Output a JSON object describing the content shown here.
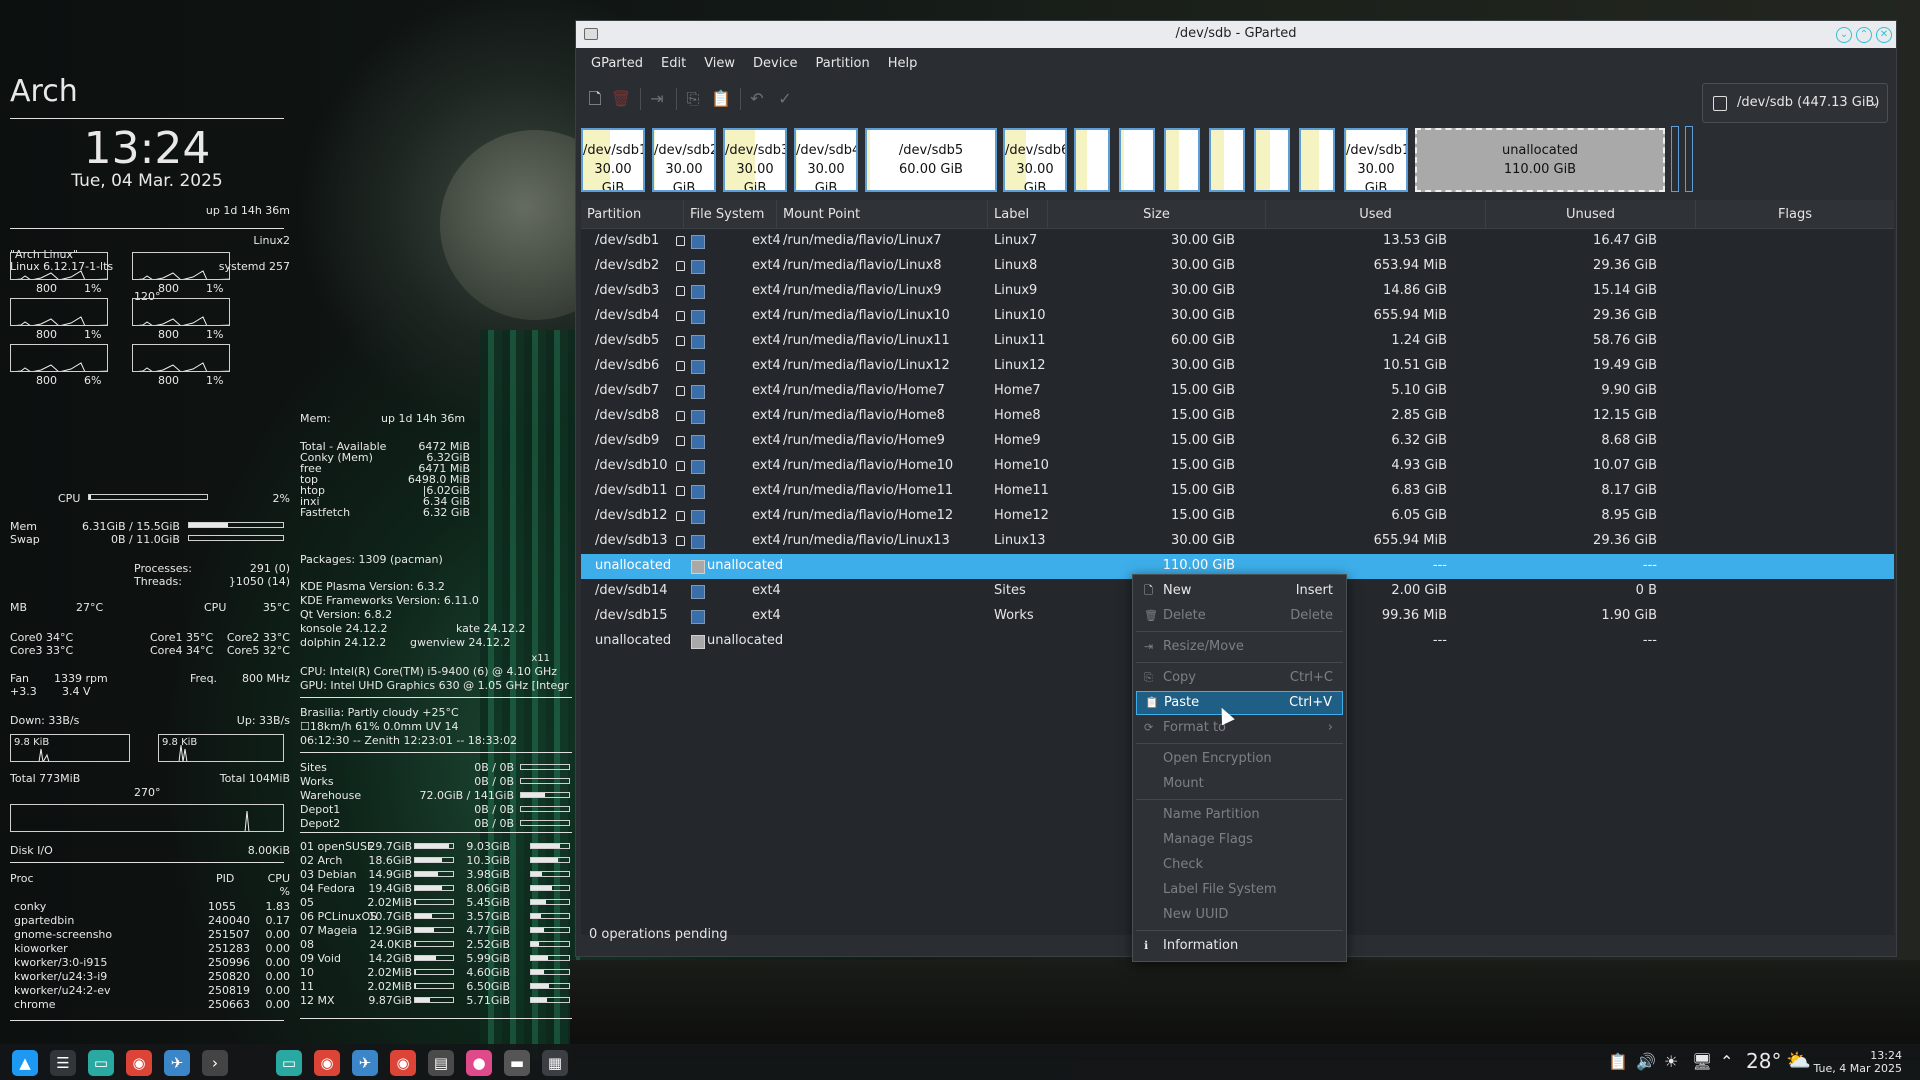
{
  "conky": {
    "distro": "Arch",
    "time": "13:24",
    "date": "Tue, 04 Mar. 2025",
    "uptime": "up  1d 14h 36m",
    "kernel_label": "Linux2",
    "os_name": "\"Arch Linux\"",
    "kernel": "Linux 6.12.17-1-lts",
    "systemd": "systemd 257",
    "cpu_temp_label": "120°",
    "cpu_cores": [
      {
        "freq": "800",
        "pct": "1%"
      },
      {
        "freq": "800",
        "pct": "1%"
      },
      {
        "freq": "800",
        "pct": "1%"
      },
      {
        "freq": "800",
        "pct": "1%"
      },
      {
        "freq": "800",
        "pct": "6%"
      },
      {
        "freq": "800",
        "pct": "1%"
      }
    ],
    "cpu_label": "CPU",
    "cpu_total": "2%",
    "cpu_total_value": 0.02,
    "mem_label": "Mem",
    "mem_value": "6.31GiB / 15.5GiB",
    "mem_fraction": 0.41,
    "swap_label": "Swap",
    "swap_value": "0B / 11.0GiB",
    "swap_fraction": 0.0,
    "processes_label": "Processes:",
    "processes": "291 (0)",
    "threads_label": "Threads:",
    "threads": "}1050 (14)",
    "mb_label": "MB",
    "mb_temp": "27°C",
    "cpu_temp_label2": "CPU",
    "cpu_temp": "35°C",
    "core_temps": [
      "Core0  34°C",
      "Core1  35°C",
      "Core2  33°C",
      "Core3  33°C",
      "Core4  34°C",
      "Core5  32°C"
    ],
    "fan_label": "Fan",
    "fan": "1339 rpm",
    "freq_label": "Freq.",
    "freq": "800   MHz",
    "volt1": "+3.3",
    "volt2": "3.4 V",
    "down": "Down: 33B/s",
    "up": "Up: 33B/s",
    "down_graph": "9.8 KiB",
    "up_graph": "9.8 KiB",
    "total_down": "Total 773MiB",
    "total_up": "Total 104MiB",
    "io_angle": "270°",
    "disk_io_label": "Disk I/O",
    "disk_io": "8.00KiB",
    "proc_header": [
      "Proc",
      "PID",
      "CPU"
    ],
    "proc_pct": "%",
    "procs": [
      [
        "conky",
        "1055",
        "1.83"
      ],
      [
        "gpartedbin",
        "240040",
        "0.17"
      ],
      [
        "gnome-screensho",
        "251507",
        "0.00"
      ],
      [
        "kioworker",
        "251283",
        "0.00"
      ],
      [
        "kworker/3:0-i915",
        "250996",
        "0.00"
      ],
      [
        "kworker/u24:3-i9",
        "250820",
        "0.00"
      ],
      [
        "kworker/u24:2-ev",
        "250819",
        "0.00"
      ],
      [
        "chrome",
        "250663",
        "0.00"
      ]
    ],
    "mem2_label": "Mem:",
    "mem2_uptime": "up  1d 14h 36m",
    "mem_rows": [
      [
        "Total - Available",
        "6472 MiB"
      ],
      [
        "Conky (Mem)",
        "6.32GiB"
      ],
      [
        "free",
        "6471   MiB"
      ],
      [
        "top",
        "6498.0  MiB"
      ],
      [
        "htop",
        "|6.02GiB"
      ],
      [
        "inxi",
        "6.34 GiB"
      ],
      [
        "Fastfetch",
        "6.32 GiB"
      ]
    ],
    "packages": "Packages: 1309 (pacman)",
    "kde_lines": [
      "KDE Plasma Version: 6.3.2",
      "KDE Frameworks Version: 6.11.0",
      "Qt Version: 6.8.2"
    ],
    "apps": [
      [
        "konsole 24.12.2",
        "kate 24.12.2"
      ],
      [
        "dolphin 24.12.2",
        "gwenview 24.12.2"
      ]
    ],
    "x11": "x11",
    "cpu_model": "CPU: Intel(R) Core(TM) i5-9400 (6) @ 4.10 GHz",
    "gpu_model": "GPU: Intel UHD Graphics 630 @ 1.05 GHz [Integr",
    "weather1": "Brasilia:    Partly cloudy  +25°C",
    "weather2": "☐18km/h    61%    0.0mm    UV 14",
    "weather3": "06:12:30 -- Zenith 12:23:01 -- 18:33:02",
    "mounts": [
      [
        "Sites",
        "0B  /   0B",
        0.0
      ],
      [
        "Works",
        "0B  /   0B",
        0.0
      ],
      [
        "Warehouse",
        "72.0GiB  /   141GiB",
        0.51
      ],
      [
        "Depot1",
        "0B  /   0B",
        0.0
      ],
      [
        "Depot2",
        "0B  /   0B",
        0.0
      ]
    ],
    "distros": [
      [
        "01 openSUSE",
        "29.7GiB",
        0.9,
        "9.03GiB",
        0.75
      ],
      [
        "02 Arch",
        "18.6GiB",
        0.7,
        "10.3GiB",
        0.7
      ],
      [
        "03 Debian",
        "14.9GiB",
        0.6,
        "3.98GiB",
        0.3
      ],
      [
        "04 Fedora",
        "19.4GiB",
        0.7,
        "8.06GiB",
        0.55
      ],
      [
        "05",
        "2.02MiB",
        0.02,
        "5.45GiB",
        0.4
      ],
      [
        "06 PCLinuxOS",
        "10.7GiB",
        0.45,
        "3.57GiB",
        0.25
      ],
      [
        "07 Mageia",
        "12.9GiB",
        0.5,
        "4.77GiB",
        0.35
      ],
      [
        "08",
        "24.0KiB",
        0.02,
        "2.52GiB",
        0.2
      ],
      [
        "09 Void",
        "14.2GiB",
        0.55,
        "5.99GiB",
        0.45
      ],
      [
        "10",
        "2.02MiB",
        0.02,
        "4.60GiB",
        0.35
      ],
      [
        "11",
        "2.02MiB",
        0.02,
        "6.50GiB",
        0.48
      ],
      [
        "12 MX",
        "9.87GiB",
        0.4,
        "5.71GiB",
        0.42
      ]
    ]
  },
  "window": {
    "title": "/dev/sdb - GParted",
    "menu": [
      "GParted",
      "Edit",
      "View",
      "Device",
      "Partition",
      "Help"
    ],
    "toolbar": [
      "new-icon",
      "delete-icon",
      "resize-icon",
      "copy-icon",
      "paste-icon",
      "undo-icon",
      "apply-icon"
    ],
    "device": "/dev/sdb (447.13 GiB)",
    "columns": [
      "Partition",
      "File System",
      "Mount Point",
      "Label",
      "Size",
      "Used",
      "Unused",
      "Flags"
    ],
    "status": "0 operations pending",
    "fs_color": "#3a6ea8",
    "selection_color": "#3daee9"
  },
  "partition_map": [
    {
      "name": "/dev/sdb1",
      "size": "30.00 GiB",
      "used": 0.45
    },
    {
      "name": "/dev/sdb2",
      "size": "30.00 GiB",
      "used": 0.02
    },
    {
      "name": "/dev/sdb3",
      "size": "30.00 GiB",
      "used": 0.5
    },
    {
      "name": "/dev/sdb4",
      "size": "30.00 GiB",
      "used": 0.02
    },
    {
      "name": "/dev/sdb5",
      "size": "60.00 GiB",
      "used": 0.02
    },
    {
      "name": "/dev/sdb6",
      "size": "30.00 GiB",
      "used": 0.35
    },
    {
      "name": "",
      "size": "",
      "used": 0.35
    },
    {
      "name": "",
      "size": "",
      "used": 0.1
    },
    {
      "name": "",
      "size": "",
      "used": 0.4
    },
    {
      "name": "",
      "size": "",
      "used": 0.4
    },
    {
      "name": "",
      "size": "",
      "used": 0.45
    },
    {
      "name": "",
      "size": "",
      "used": 0.55
    },
    {
      "name": "/dev/sdb13",
      "size": "30.00 GiB",
      "used": 0.02
    },
    {
      "name": "unallocated",
      "size": "110.00 GiB",
      "used": 0.0
    }
  ],
  "partitions": [
    {
      "part": "/dev/sdb1",
      "fs": "ext4",
      "mount": "/run/media/flavio/Linux7",
      "label": "Linux7",
      "size": "30.00 GiB",
      "used": "13.53 GiB",
      "unused": "16.47 GiB",
      "lock": true
    },
    {
      "part": "/dev/sdb2",
      "fs": "ext4",
      "mount": "/run/media/flavio/Linux8",
      "label": "Linux8",
      "size": "30.00 GiB",
      "used": "653.94 MiB",
      "unused": "29.36 GiB",
      "lock": true
    },
    {
      "part": "/dev/sdb3",
      "fs": "ext4",
      "mount": "/run/media/flavio/Linux9",
      "label": "Linux9",
      "size": "30.00 GiB",
      "used": "14.86 GiB",
      "unused": "15.14 GiB",
      "lock": true
    },
    {
      "part": "/dev/sdb4",
      "fs": "ext4",
      "mount": "/run/media/flavio/Linux10",
      "label": "Linux10",
      "size": "30.00 GiB",
      "used": "655.94 MiB",
      "unused": "29.36 GiB",
      "lock": true
    },
    {
      "part": "/dev/sdb5",
      "fs": "ext4",
      "mount": "/run/media/flavio/Linux11",
      "label": "Linux11",
      "size": "60.00 GiB",
      "used": "1.24 GiB",
      "unused": "58.76 GiB",
      "lock": true
    },
    {
      "part": "/dev/sdb6",
      "fs": "ext4",
      "mount": "/run/media/flavio/Linux12",
      "label": "Linux12",
      "size": "30.00 GiB",
      "used": "10.51 GiB",
      "unused": "19.49 GiB",
      "lock": true
    },
    {
      "part": "/dev/sdb7",
      "fs": "ext4",
      "mount": "/run/media/flavio/Home7",
      "label": "Home7",
      "size": "15.00 GiB",
      "used": "5.10 GiB",
      "unused": "9.90 GiB",
      "lock": true
    },
    {
      "part": "/dev/sdb8",
      "fs": "ext4",
      "mount": "/run/media/flavio/Home8",
      "label": "Home8",
      "size": "15.00 GiB",
      "used": "2.85 GiB",
      "unused": "12.15 GiB",
      "lock": true
    },
    {
      "part": "/dev/sdb9",
      "fs": "ext4",
      "mount": "/run/media/flavio/Home9",
      "label": "Home9",
      "size": "15.00 GiB",
      "used": "6.32 GiB",
      "unused": "8.68 GiB",
      "lock": true
    },
    {
      "part": "/dev/sdb10",
      "fs": "ext4",
      "mount": "/run/media/flavio/Home10",
      "label": "Home10",
      "size": "15.00 GiB",
      "used": "4.93 GiB",
      "unused": "10.07 GiB",
      "lock": true
    },
    {
      "part": "/dev/sdb11",
      "fs": "ext4",
      "mount": "/run/media/flavio/Home11",
      "label": "Home11",
      "size": "15.00 GiB",
      "used": "6.83 GiB",
      "unused": "8.17 GiB",
      "lock": true
    },
    {
      "part": "/dev/sdb12",
      "fs": "ext4",
      "mount": "/run/media/flavio/Home12",
      "label": "Home12",
      "size": "15.00 GiB",
      "used": "6.05 GiB",
      "unused": "8.95 GiB",
      "lock": true
    },
    {
      "part": "/dev/sdb13",
      "fs": "ext4",
      "mount": "/run/media/flavio/Linux13",
      "label": "Linux13",
      "size": "30.00 GiB",
      "used": "655.94 MiB",
      "unused": "29.36 GiB",
      "lock": true
    },
    {
      "part": "unallocated",
      "fs": "unallocated",
      "mount": "",
      "label": "",
      "size": "110.00 GiB",
      "used": "---",
      "unused": "---",
      "lock": false,
      "unalloc": true,
      "selected": true
    },
    {
      "part": "/dev/sdb14",
      "fs": "ext4",
      "mount": "",
      "label": "Sites",
      "size": "",
      "used": "2.00 GiB",
      "unused": "0 B",
      "lock": false
    },
    {
      "part": "/dev/sdb15",
      "fs": "ext4",
      "mount": "",
      "label": "Works",
      "size": "",
      "used": "99.36 MiB",
      "unused": "1.90 GiB",
      "lock": false
    },
    {
      "part": "unallocated",
      "fs": "unallocated",
      "mount": "",
      "label": "",
      "size": "",
      "used": "---",
      "unused": "---",
      "lock": false,
      "unalloc": true
    }
  ],
  "context_menu": [
    {
      "label": "New",
      "shortcut": "Insert",
      "icon": "new-icon",
      "enabled": true
    },
    {
      "label": "Delete",
      "shortcut": "Delete",
      "icon": "delete-icon",
      "enabled": false
    },
    {
      "sep": true
    },
    {
      "label": "Resize/Move",
      "shortcut": "",
      "icon": "resize-icon",
      "enabled": false
    },
    {
      "sep": true
    },
    {
      "label": "Copy",
      "shortcut": "Ctrl+C",
      "icon": "copy-icon",
      "enabled": false
    },
    {
      "label": "Paste",
      "shortcut": "Ctrl+V",
      "icon": "paste-icon",
      "enabled": true,
      "highlight": true
    },
    {
      "label": "Format to",
      "shortcut": "›",
      "icon": "format-icon",
      "enabled": false
    },
    {
      "sep": true
    },
    {
      "label": "Open Encryption",
      "shortcut": "",
      "icon": "",
      "enabled": false
    },
    {
      "label": "Mount",
      "shortcut": "",
      "icon": "",
      "enabled": false
    },
    {
      "sep": true
    },
    {
      "label": "Name Partition",
      "shortcut": "",
      "icon": "",
      "enabled": false
    },
    {
      "label": "Manage Flags",
      "shortcut": "",
      "icon": "",
      "enabled": false
    },
    {
      "label": "Check",
      "shortcut": "",
      "icon": "",
      "enabled": false
    },
    {
      "label": "Label File System",
      "shortcut": "",
      "icon": "",
      "enabled": false
    },
    {
      "label": "New UUID",
      "shortcut": "",
      "icon": "",
      "enabled": false
    },
    {
      "sep": true
    },
    {
      "label": "Information",
      "shortcut": "",
      "icon": "info-icon",
      "enabled": true
    }
  ],
  "taskbar": {
    "apps": [
      "launcher-icon",
      "system-monitor-icon",
      "files-icon",
      "chrome-icon",
      "browser-icon",
      "terminal-icon",
      "folder-icon",
      "chrome-icon",
      "browser-icon",
      "chrome-icon",
      "book-icon",
      "record-icon",
      "gparted-icon",
      "calculator-icon"
    ],
    "temperature": "28°",
    "time": "13:24",
    "date": "Tue, 4 Mar 2025"
  }
}
